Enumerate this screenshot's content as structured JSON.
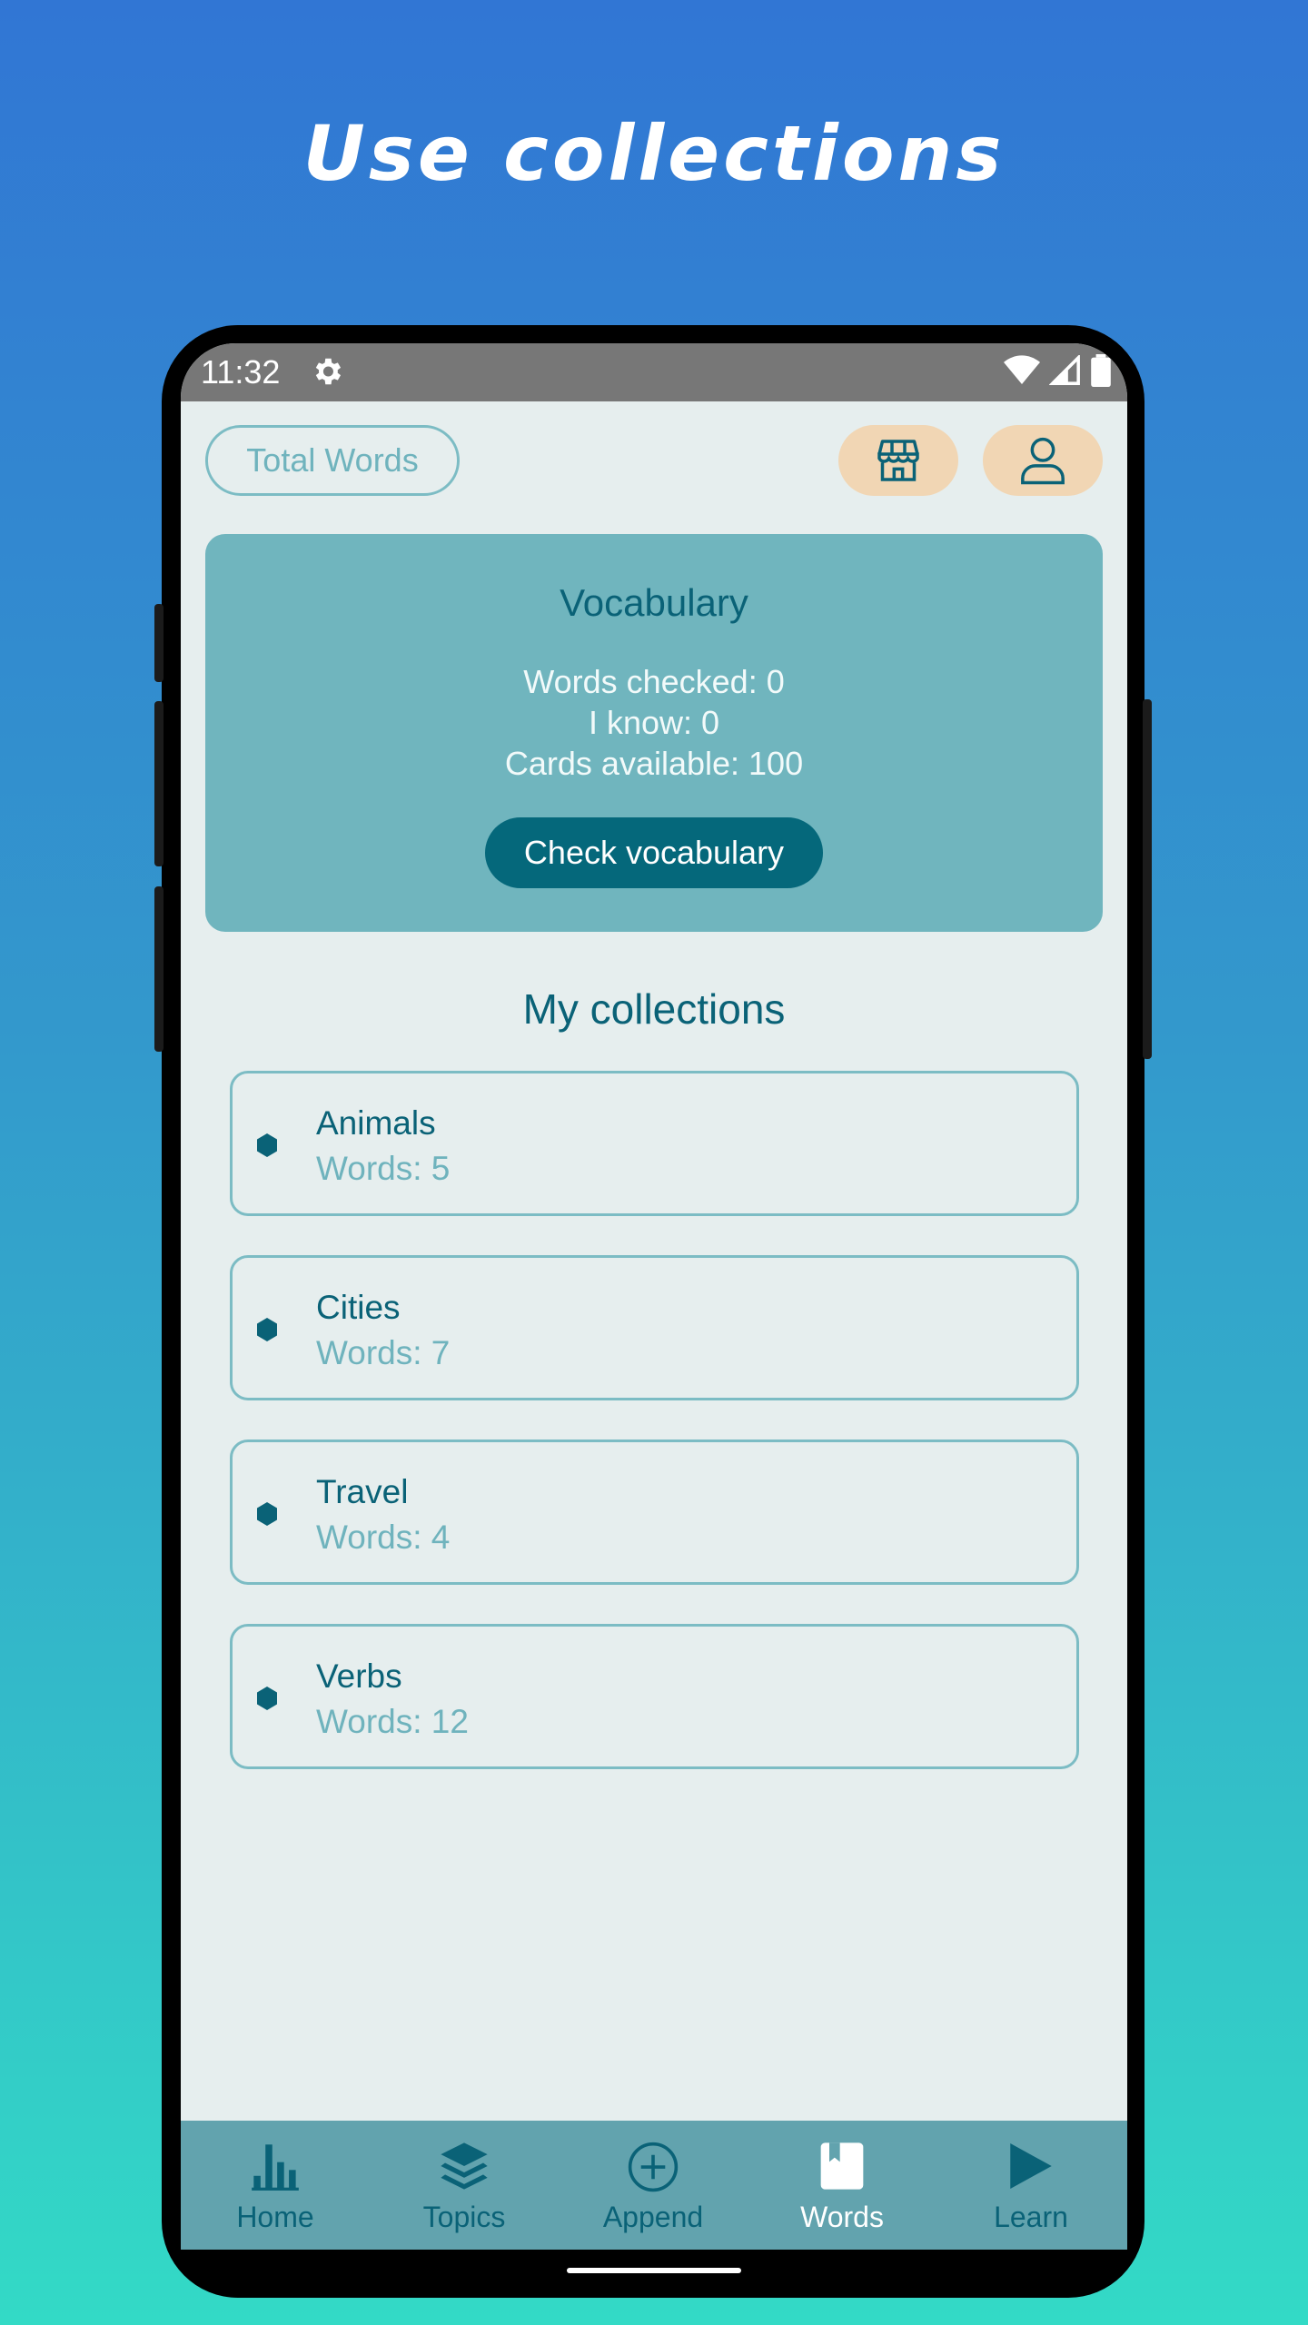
{
  "headline": "Use collections",
  "statusbar": {
    "time": "11:32"
  },
  "header": {
    "total_words_label": "Total Words"
  },
  "vocabulary": {
    "title": "Vocabulary",
    "words_checked": "Words checked: 0",
    "i_know": "I know: 0",
    "cards_available": "Cards available: 100",
    "check_button": "Check vocabulary"
  },
  "collections": {
    "title": "My collections",
    "items": [
      {
        "name": "Animals",
        "count": "Words: 5"
      },
      {
        "name": "Cities",
        "count": "Words: 7"
      },
      {
        "name": "Travel",
        "count": "Words: 4"
      },
      {
        "name": "Verbs",
        "count": "Words: 12"
      }
    ]
  },
  "nav": {
    "items": [
      {
        "label": "Home",
        "icon": "bar-chart-icon"
      },
      {
        "label": "Topics",
        "icon": "layers-icon"
      },
      {
        "label": "Append",
        "icon": "add-circle-icon"
      },
      {
        "label": "Words",
        "icon": "book-icon",
        "active": true
      },
      {
        "label": "Learn",
        "icon": "play-icon"
      }
    ]
  },
  "colors": {
    "accent_dark": "#0a6277",
    "accent_light": "#70b5be",
    "button_peach": "#f1d6b4",
    "nav_bg": "#62a3ae"
  }
}
